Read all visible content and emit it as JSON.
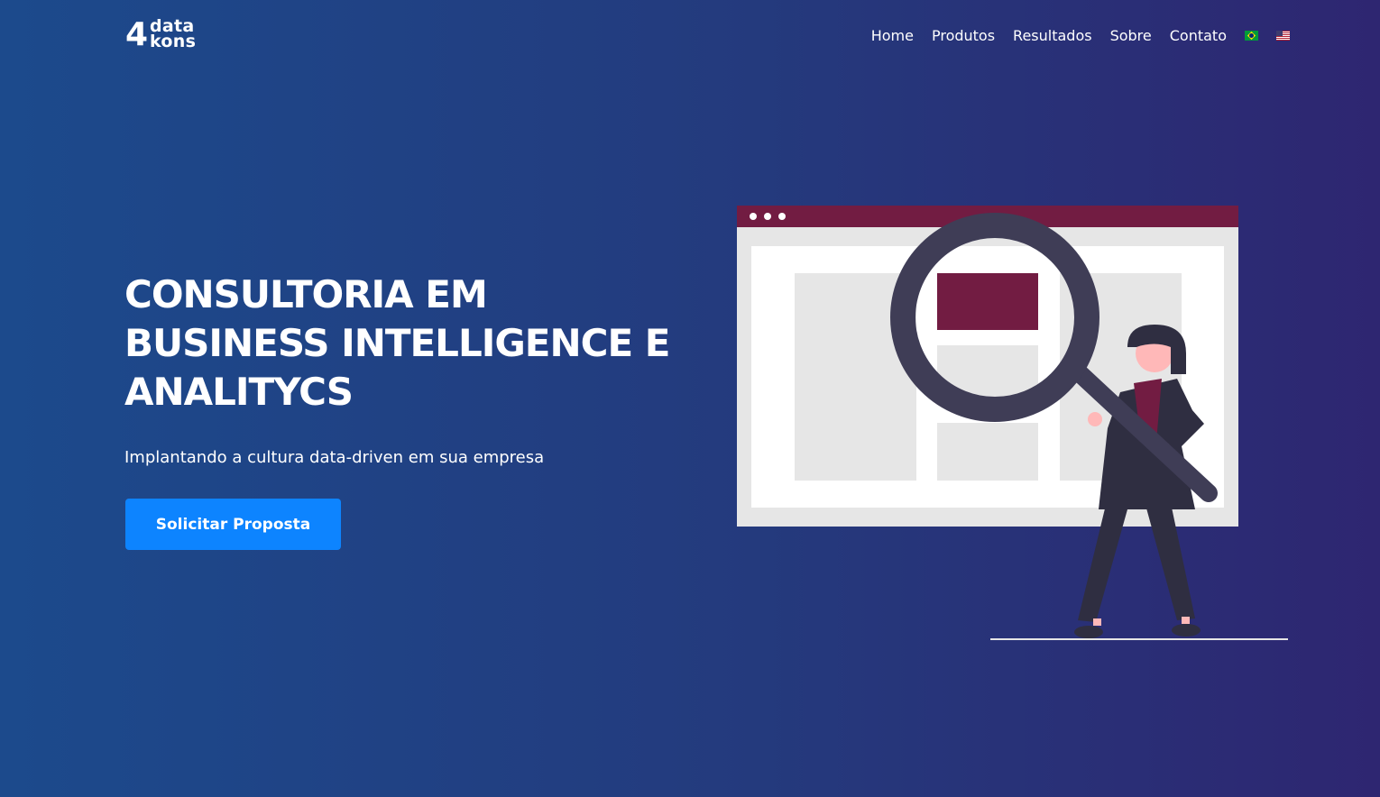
{
  "brand": {
    "logo_digit": "4",
    "logo_word_top": "data",
    "logo_word_bottom": "kons"
  },
  "nav": {
    "items": [
      "Home",
      "Produtos",
      "Resultados",
      "Sobre",
      "Contato"
    ],
    "languages": [
      "flag-brazil-icon",
      "flag-usa-icon"
    ]
  },
  "hero": {
    "headline": "CONSULTORIA EM BUSINESS INTELLIGENCE E ANALITYCS",
    "subtitle": "Implantando a cultura data-driven em sua empresa",
    "cta_label": "Solicitar Proposta"
  },
  "colors": {
    "background_start": "#1c4a8c",
    "background_end": "#2e2671",
    "cta": "#0d84ff",
    "accent": "#721c42",
    "dark": "#3f3d56"
  }
}
